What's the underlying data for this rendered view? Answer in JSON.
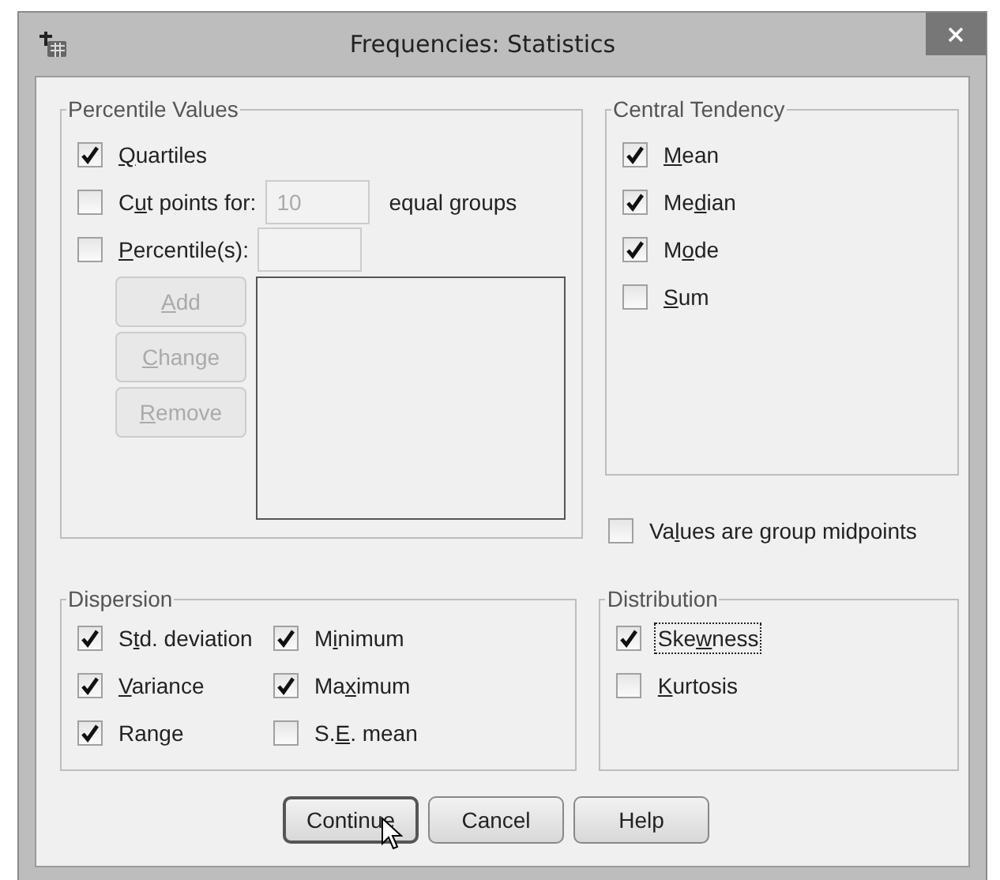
{
  "window": {
    "title": "Frequencies: Statistics"
  },
  "percentile_values": {
    "title": "Percentile Values",
    "quartiles": {
      "mnemonic": "Q",
      "post": "uartiles",
      "checked": true
    },
    "cut_points": {
      "pre": "C",
      "mnemonic": "u",
      "post": "t points for:",
      "checked": false,
      "value": "10",
      "field_disabled": true,
      "suffix": "equal groups"
    },
    "percentiles": {
      "mnemonic": "P",
      "post": "ercentile(s):",
      "checked": false
    },
    "buttons": [
      {
        "mnemonic": "A",
        "post": "dd",
        "disabled": true
      },
      {
        "mnemonic": "C",
        "post": "hange",
        "disabled": true
      },
      {
        "mnemonic": "R",
        "post": "emove",
        "disabled": true
      }
    ]
  },
  "central_tendency": {
    "title": "Central Tendency",
    "items": [
      {
        "mnemonic": "M",
        "post": "ean",
        "checked": true
      },
      {
        "pre": "Me",
        "mnemonic": "d",
        "post": "ian",
        "checked": true
      },
      {
        "pre": "M",
        "mnemonic": "o",
        "post": "de",
        "checked": true
      },
      {
        "mnemonic": "S",
        "post": "um",
        "checked": false
      }
    ]
  },
  "group_midpoints": {
    "pre": "Va",
    "mnemonic": "l",
    "post": "ues are group midpoints",
    "checked": false
  },
  "dispersion": {
    "title": "Dispersion",
    "items": [
      {
        "pre": "S",
        "mnemonic": "t",
        "post": "d. deviation",
        "checked": true
      },
      {
        "pre": "M",
        "mnemonic": "i",
        "post": "nimum",
        "checked": true
      },
      {
        "mnemonic": "V",
        "post": "ariance",
        "checked": true
      },
      {
        "pre": "Ma",
        "mnemonic": "x",
        "post": "imum",
        "checked": true
      },
      {
        "pre": "Range",
        "checked": true
      },
      {
        "pre": "S.",
        "mnemonic": "E",
        "post": ". mean",
        "checked": false
      }
    ]
  },
  "distribution": {
    "title": "Distribution",
    "items": [
      {
        "pre": "Ske",
        "mnemonic": "w",
        "post": "ness",
        "checked": true,
        "focused": true
      },
      {
        "mnemonic": "K",
        "post": "urtosis",
        "checked": false,
        "focused": false
      }
    ]
  },
  "buttons": [
    {
      "label": "Continue",
      "default": true
    },
    {
      "label": "Cancel",
      "default": false
    },
    {
      "label": "Help",
      "default": false
    }
  ]
}
